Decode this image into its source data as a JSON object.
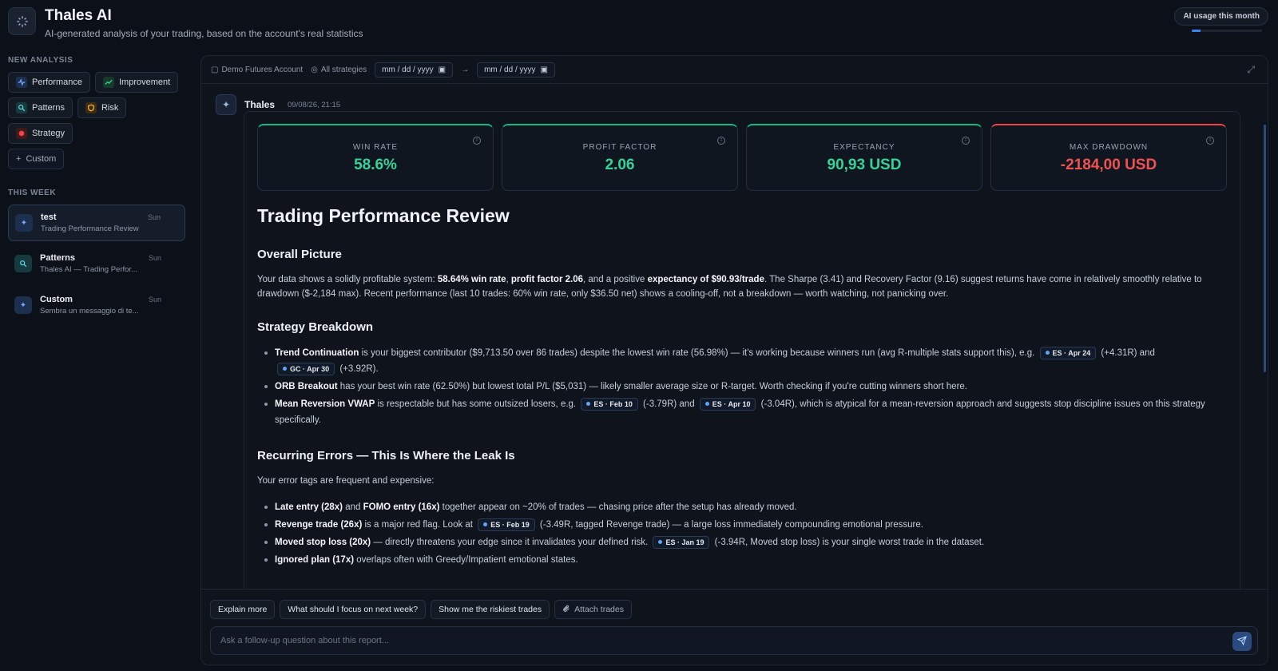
{
  "app": {
    "title": "Thales AI",
    "subtitle": "AI-generated analysis of your trading, based on the account's real statistics",
    "usage_label": "AI usage this month",
    "usage_fraction": 0.12
  },
  "sidebar": {
    "new_analysis_label": "NEW ANALYSIS",
    "analysis_buttons": [
      {
        "label": "Performance",
        "icon": "pulse-icon"
      },
      {
        "label": "Improvement",
        "icon": "trend-up-icon"
      },
      {
        "label": "Patterns",
        "icon": "search-icon"
      },
      {
        "label": "Risk",
        "icon": "shield-icon"
      },
      {
        "label": "Strategy",
        "icon": "target-icon"
      }
    ],
    "custom_label": "Custom",
    "this_week_label": "THIS WEEK",
    "conversations": [
      {
        "title": "test",
        "subtitle": "Trading Performance Review",
        "day": "Sun"
      },
      {
        "title": "Patterns",
        "subtitle": "Thales AI — Trading Perfor...",
        "day": "Sun"
      },
      {
        "title": "Custom",
        "subtitle": "Sembra un messaggio di te...",
        "day": "Sun"
      }
    ]
  },
  "filters": {
    "account": "Demo Futures Account",
    "strategies": "All strategies",
    "date_from_placeholder": "mm / dd / yyyy",
    "date_to_placeholder": "mm / dd / yyyy",
    "arrow": "→"
  },
  "message": {
    "author": "Thales",
    "timestamp": "09/08/26, 21:15"
  },
  "stats": [
    {
      "label": "WIN RATE",
      "value": "58.6%"
    },
    {
      "label": "PROFIT FACTOR",
      "value": "2.06"
    },
    {
      "label": "EXPECTANCY",
      "value": "90,93 USD"
    },
    {
      "label": "MAX DRAWDOWN",
      "value": "-2184,00 USD"
    }
  ],
  "report": {
    "title": "Trading Performance Review",
    "overall": {
      "heading": "Overall Picture",
      "p1": "Your data shows a solidly profitable system: ",
      "b1": "58.64% win rate",
      "p2": ", ",
      "b2": "profit factor 2.06",
      "p3": ", and a positive ",
      "b3": "expectancy of $90.93/trade",
      "p4": ". The Sharpe (3.41) and Recovery Factor (9.16) suggest returns have come in relatively smoothly relative to drawdown ($-2,184 max). Recent performance (last 10 trades: 60% win rate, only $36.50 net) shows a cooling-off, not a breakdown — worth watching, not panicking over."
    },
    "strategy": {
      "heading": "Strategy Breakdown",
      "b1": {
        "strong": "Trend Continuation",
        "t1": " is your biggest contributor ($9,713.50 over 86 trades) despite the lowest win rate (56.98%) — it's working because winners run (avg R-multiple stats support this), e.g. ",
        "tag1": "ES · Apr 24",
        "t2": " (+4.31R) and ",
        "tag2": "GC · Apr 30",
        "t3": " (+3.92R)."
      },
      "b2": {
        "strong": "ORB Breakout",
        "t1": " has your best win rate (62.50%) but lowest total P/L ($5,031) — likely smaller average size or R-target. Worth checking if you're cutting winners short here."
      },
      "b3": {
        "strong": "Mean Reversion VWAP",
        "t1": " is respectable but has some outsized losers, e.g. ",
        "tag1": "ES · Feb 10",
        "t2": " (-3.79R) and ",
        "tag2": "ES · Apr 10",
        "t3": " (-3.04R), which is atypical for a mean-reversion approach and suggests stop discipline issues on this strategy specifically."
      }
    },
    "errors": {
      "heading": "Recurring Errors — This Is Where the Leak Is",
      "intro": "Your error tags are frequent and expensive:",
      "b1": {
        "s1": "Late entry (28x)",
        "t1": " and ",
        "s2": "FOMO entry (16x)",
        "t2": " together appear on ~20% of trades — chasing price after the setup has already moved."
      },
      "b2": {
        "s1": "Revenge trade (26x)",
        "t1": " is a major red flag. Look at ",
        "tag": "ES · Feb 19",
        "t2": " (-3.49R, tagged Revenge trade) — a large loss immediately compounding emotional pressure."
      },
      "b3": {
        "s1": "Moved stop loss (20x)",
        "t1": " — directly threatens your edge since it invalidates your defined risk. ",
        "tag": "ES · Jan 19",
        "t2": " (-3.94R, Moved stop loss) is your single worst trade in the dataset."
      },
      "b4": {
        "s1": "Ignored plan (17x)",
        "t1": " overlaps often with Greedy/Impatient emotional states."
      }
    }
  },
  "composer": {
    "suggestions": [
      "Explain more",
      "What should I focus on next week?",
      "Show me the riskiest trades"
    ],
    "attach_label": "Attach trades",
    "placeholder": "Ask a follow-up question about this report..."
  },
  "colors": {
    "positive": "#34d399",
    "negative": "#f05252",
    "accent": "#3b82f6"
  }
}
